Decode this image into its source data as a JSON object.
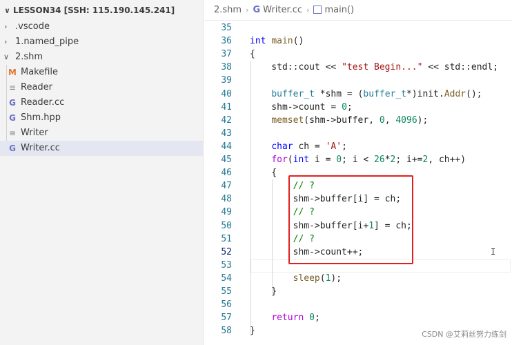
{
  "explorer": {
    "header": "LESSON34 [SSH: 115.190.145.241]",
    "items": [
      {
        "label": ".vscode",
        "type": "folder",
        "state": "collapsed"
      },
      {
        "label": "1.named_pipe",
        "type": "folder",
        "state": "collapsed"
      },
      {
        "label": "2.shm",
        "type": "folder",
        "state": "expanded"
      },
      {
        "label": "Makefile",
        "type": "file",
        "icon": "M"
      },
      {
        "label": "Reader",
        "type": "file",
        "icon": "lines-icon"
      },
      {
        "label": "Reader.cc",
        "type": "file",
        "icon": "C"
      },
      {
        "label": "Shm.hpp",
        "type": "file",
        "icon": "C"
      },
      {
        "label": "Writer",
        "type": "file",
        "icon": "lines-icon"
      },
      {
        "label": "Writer.cc",
        "type": "file",
        "icon": "C",
        "selected": true
      }
    ]
  },
  "breadcrumb": {
    "folder": "2.shm",
    "file": "Writer.cc",
    "symbol": "main()"
  },
  "editor": {
    "lines": [
      {
        "n": "35",
        "code": ""
      },
      {
        "n": "36",
        "code": "int main()"
      },
      {
        "n": "37",
        "code": "{"
      },
      {
        "n": "38",
        "code": "    std::cout << \"test Begin...\" << std::endl;"
      },
      {
        "n": "39",
        "code": ""
      },
      {
        "n": "40",
        "code": "    buffer_t *shm = (buffer_t*)init.Addr();"
      },
      {
        "n": "41",
        "code": "    shm->count = 0;"
      },
      {
        "n": "42",
        "code": "    memset(shm->buffer, 0, 4096);"
      },
      {
        "n": "43",
        "code": ""
      },
      {
        "n": "44",
        "code": "    char ch = 'A';"
      },
      {
        "n": "45",
        "code": "    for(int i = 0; i < 26*2; i+=2, ch++)"
      },
      {
        "n": "46",
        "code": "    {"
      },
      {
        "n": "47",
        "code": "        // ?"
      },
      {
        "n": "48",
        "code": "        shm->buffer[i] = ch;"
      },
      {
        "n": "49",
        "code": "        // ?"
      },
      {
        "n": "50",
        "code": "        shm->buffer[i+1] = ch;"
      },
      {
        "n": "51",
        "code": "        // ?"
      },
      {
        "n": "52",
        "code": "        shm->count++;"
      },
      {
        "n": "53",
        "code": ""
      },
      {
        "n": "54",
        "code": "        sleep(1);"
      },
      {
        "n": "55",
        "code": "    }"
      },
      {
        "n": "56",
        "code": ""
      },
      {
        "n": "57",
        "code": "    return 0;"
      },
      {
        "n": "58",
        "code": "}"
      }
    ],
    "current_line": "52"
  },
  "watermark": "CSDN @艾莉丝努力练剑",
  "colors": {
    "keyword": "#0000ff",
    "type": "#267f99",
    "function": "#795e26",
    "string": "#a31515",
    "number": "#098658",
    "comment": "#008000",
    "highlight_box": "#e02020",
    "selected_row": "#e4e6f1"
  }
}
